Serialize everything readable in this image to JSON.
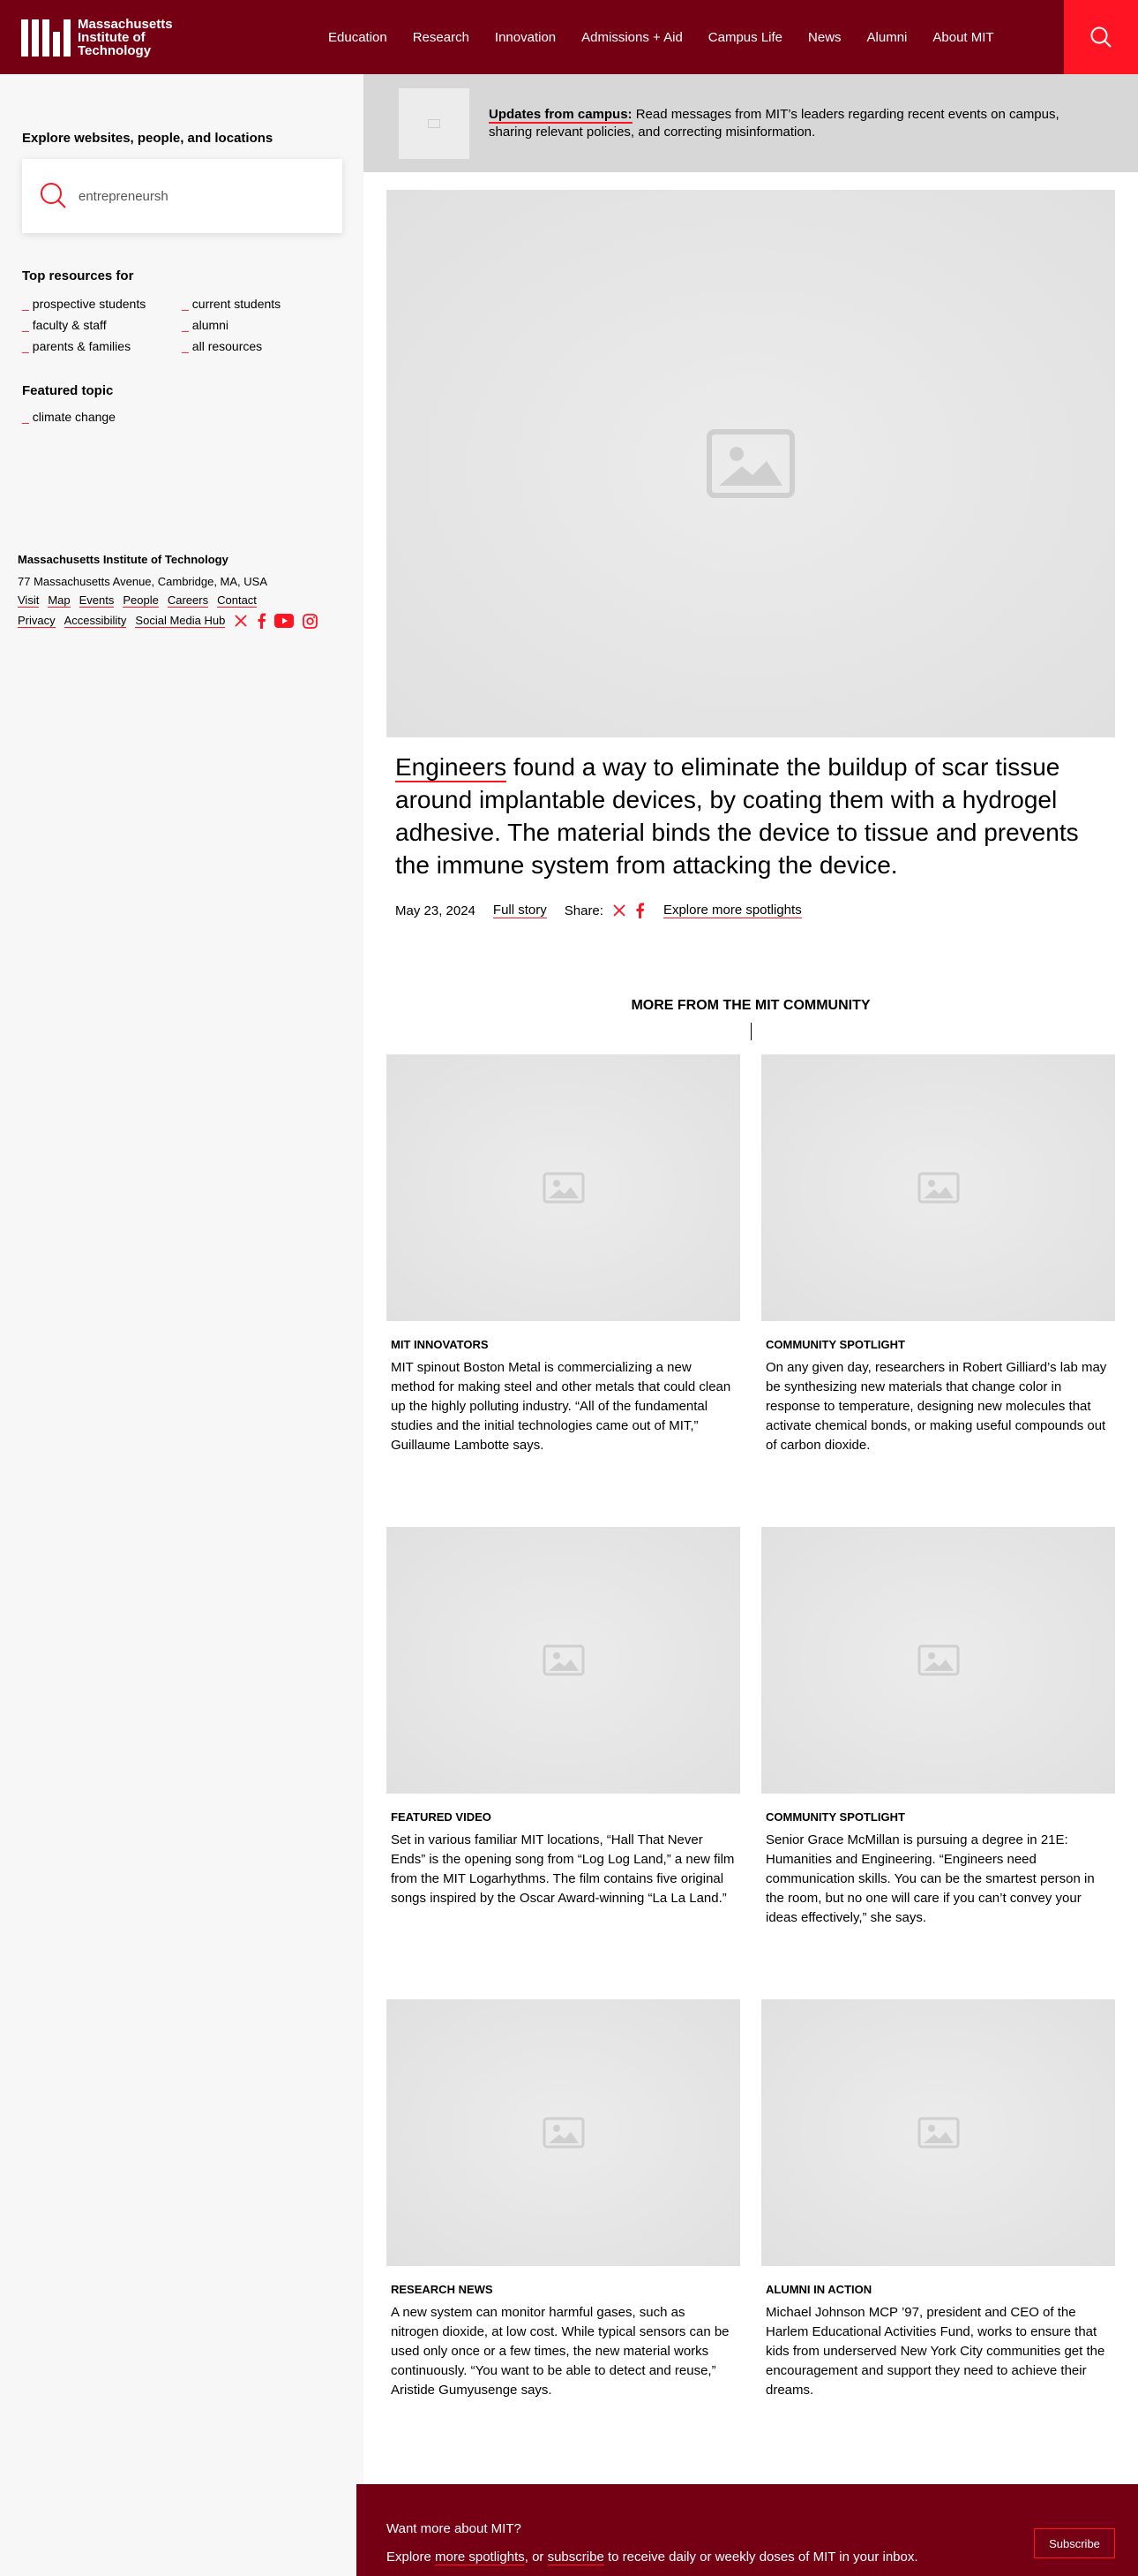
{
  "header": {
    "logo_text": "Massachusetts Institute of Technology",
    "nav": [
      "Education",
      "Research",
      "Innovation",
      "Admissions + Aid",
      "Campus Life",
      "News",
      "Alumni",
      "About MIT"
    ],
    "search_icon": "search-icon"
  },
  "sidebar": {
    "title": "Explore websites, people, and locations",
    "search_value": "entrepreneursh",
    "resources_heading": "Top resources for",
    "resources": [
      "prospective students",
      "current students",
      "faculty & staff",
      "alumni",
      "parents & families",
      "all resources"
    ],
    "featured_heading": "Featured topic",
    "featured": "climate change",
    "bullet": "_"
  },
  "site_footer": {
    "name": "Massachusetts Institute of Technology",
    "address": "77 Massachusetts Avenue, Cambridge, MA, USA",
    "links": [
      "Visit",
      "Map",
      "Events",
      "People",
      "Careers",
      "Contact"
    ],
    "links2": [
      "Privacy",
      "Accessibility",
      "Social Media Hub"
    ],
    "social_icons": [
      "x-icon",
      "facebook-icon",
      "youtube-icon",
      "instagram-icon"
    ]
  },
  "alert": {
    "label": "Updates from campus:",
    "text": " Read messages from MIT’s leaders regarding recent events on campus, sharing relevant policies, and correcting misinformation."
  },
  "hero": {
    "keyword": "Engineers",
    "caption": " found a way to eliminate the buildup of scar tissue around implantable devices, by coating them with a hydrogel adhesive. The material binds the device to tissue and prevents the immune system from attacking the device.",
    "date": "May 23, 2024",
    "full_story": "Full story",
    "share": "Share:",
    "explore": "Explore more spotlights"
  },
  "more": {
    "title": "MORE FROM THE MIT COMMUNITY",
    "cards": [
      {
        "category": "MIT INNOVATORS",
        "text": "MIT spinout Boston Metal is commercializing a new method for making steel and other metals that could clean up the highly polluting industry. “All of the fundamental studies and the initial technologies came out of MIT,” Guillaume Lambotte says."
      },
      {
        "category": "COMMUNITY SPOTLIGHT",
        "text": "On any given day, researchers in Robert Gilliard’s lab may be synthesizing new materials that change color in response to temperature, designing new molecules that activate chemical bonds, or making useful compounds out of carbon dioxide."
      },
      {
        "category": "FEATURED VIDEO",
        "text": "Set in various familiar MIT locations, “Hall That Never Ends” is the opening song from “Log Log Land,” a new film from the MIT Logarhythms. The film contains five original songs inspired by the Oscar Award-winning “La La Land.”"
      },
      {
        "category": "COMMUNITY SPOTLIGHT",
        "text": "Senior Grace McMillan is pursuing a degree in 21E: Humanities and Engineering. “Engineers need communication skills. You can be the smartest person in the room, but no one will care if you can’t convey your ideas effectively,” she says."
      },
      {
        "category": "RESEARCH NEWS",
        "text": "A new system can monitor harmful gases, such as nitrogen dioxide, at low cost. While typical sensors can be used only once or a few times, the new material works continuously. “You want to be able to detect and reuse,” Aristide Gumyusenge says."
      },
      {
        "category": "ALUMNI IN ACTION",
        "text": "Michael Johnson MCP ’97, president and CEO of the Harlem Educational Activities Fund, works to ensure that kids from underserved New York City communities get the encouragement and support they need to achieve their dreams."
      }
    ]
  },
  "newsletter": {
    "question": "Want more about MIT?",
    "pre": "Explore ",
    "spotlights": "more spotlights",
    "mid": ", or ",
    "subscribe_link": "subscribe",
    "post": " to receive daily or weekly doses of MIT in your inbox.",
    "button": "Subscribe"
  },
  "colors": {
    "maroon": "#750014",
    "red": "#ff1423",
    "sidebar_bg": "#f7f7f7",
    "alert_bg": "#d7d7d7"
  }
}
